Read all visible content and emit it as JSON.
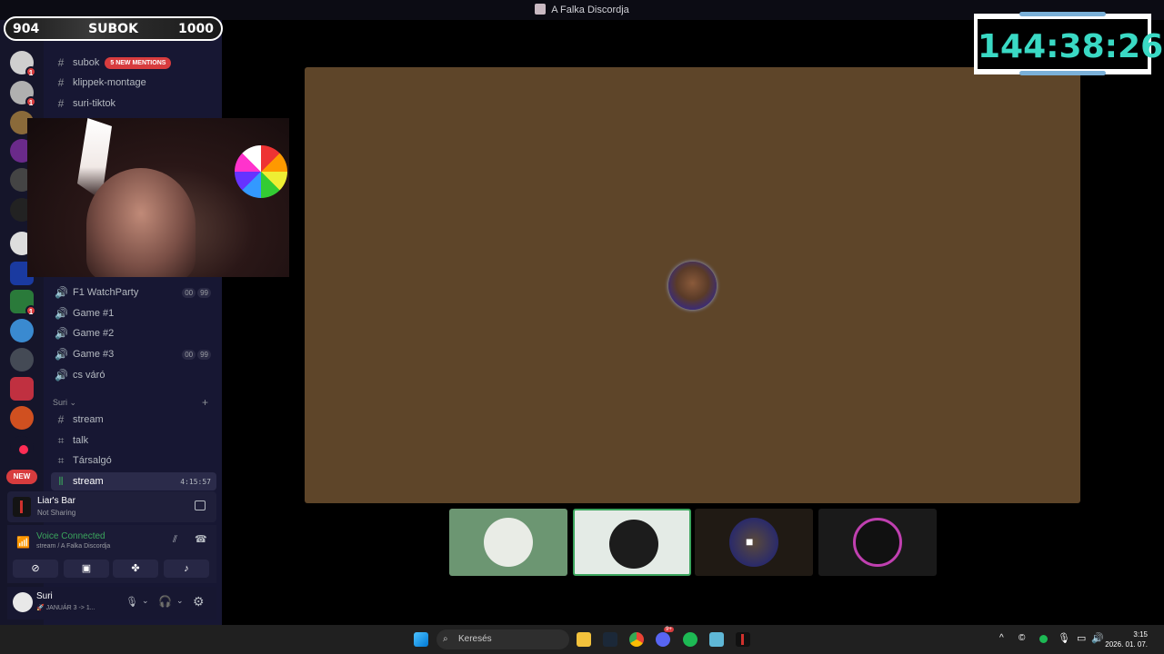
{
  "window": {
    "title": "A Falka Discordja"
  },
  "counters": {
    "left": "904",
    "center": "SUBOK",
    "right": "1000"
  },
  "timer": {
    "value": "144:38:26"
  },
  "channels": {
    "text_top": [
      {
        "label": "subok",
        "badge": "5 NEW MENTIONS"
      },
      {
        "label": "klippek-montage"
      },
      {
        "label": "suri-tiktok"
      }
    ],
    "voice": [
      {
        "label": "F1 WatchParty",
        "c1": "00",
        "c2": "99"
      },
      {
        "label": "Game #1"
      },
      {
        "label": "Game #2"
      },
      {
        "label": "Game #3",
        "c1": "00",
        "c2": "99"
      },
      {
        "label": "cs váró"
      }
    ],
    "category": "Suri",
    "suri": [
      {
        "label": "stream"
      },
      {
        "label": "talk"
      },
      {
        "label": "Társalgó"
      },
      {
        "label": "stream",
        "time": "4:15:57"
      }
    ]
  },
  "server_rail": {
    "new_label": "NEW",
    "badge_count": "1"
  },
  "activity": {
    "app_name": "Liar's Bar",
    "status": "Not Sharing"
  },
  "voice": {
    "status": "Voice Connected",
    "location": "stream / A Falka Discordja"
  },
  "user": {
    "name": "Suri",
    "status_text": "JANUÁR 3 -> 1..."
  },
  "taskbar": {
    "search_placeholder": "Keresés",
    "time": "3:15",
    "date": "2026. 01. 07.",
    "discord_badge": "9+"
  },
  "colors": {
    "accent_timer": "#3ad9c4",
    "mention_red": "#d83c3e",
    "stream_bg": "#5e4529"
  }
}
